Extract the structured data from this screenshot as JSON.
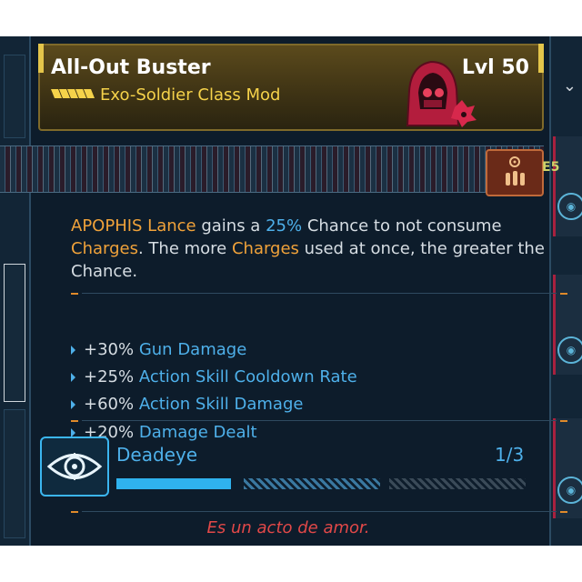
{
  "item": {
    "name": "All-Out Buster",
    "level": "Lvl 50",
    "type": "Exo-Soldier Class Mod"
  },
  "strip_badge": "E5",
  "description": {
    "part1": "APOPHIS Lance",
    "part2": " gains a ",
    "part3": "25%",
    "part4": " Chance to not consume ",
    "part5": "Charges",
    "part6": ". The more ",
    "part7": "Charges",
    "part8": " used at once, the greater the Chance."
  },
  "stats": [
    {
      "value": "+30%",
      "label": "Gun Damage"
    },
    {
      "value": "+25%",
      "label": "Action Skill Cooldown Rate"
    },
    {
      "value": "+60%",
      "label": "Action Skill Damage"
    },
    {
      "value": "+20%",
      "label": "Damage Dealt"
    }
  ],
  "skill": {
    "name": "Deadeye",
    "rank": "1/3",
    "progress": 0.33
  },
  "flavor": "Es un acto de amor.",
  "icons": {
    "rarity": "chevron-rarity-icon",
    "badge": "hooded-soldier-badge-icon",
    "strip": "biohazard-ammo-icon",
    "skill": "eye-crosshair-icon"
  },
  "colors": {
    "rarity_gold": "#f5d24a",
    "highlight_orange": "#f0a23a",
    "stat_blue": "#4eb0ea",
    "flavor_red": "#e24848"
  }
}
